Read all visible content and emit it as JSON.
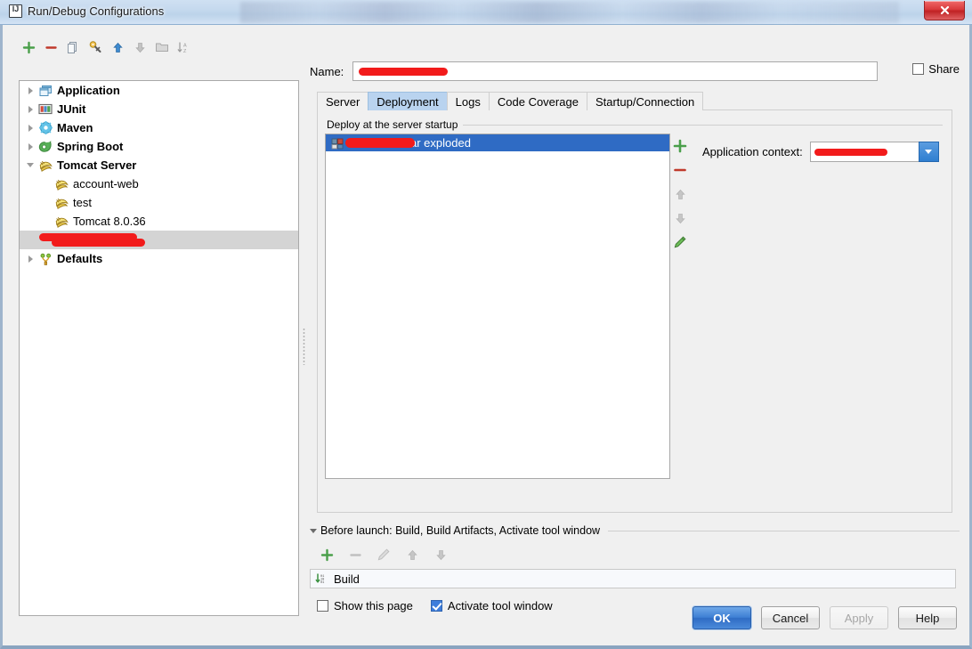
{
  "window": {
    "title": "Run/Debug Configurations",
    "logo_icon": "intellij-idea-icon",
    "close_label": "✕"
  },
  "left_toolbar": {
    "buttons": [
      {
        "name": "add-configuration-button",
        "icon": "plus-icon",
        "tooltip": "Add New Configuration",
        "enabled": true
      },
      {
        "name": "remove-configuration-button",
        "icon": "minus-icon",
        "tooltip": "Remove Configuration",
        "enabled": true
      },
      {
        "name": "copy-configuration-button",
        "icon": "copy-icon",
        "tooltip": "Copy Configuration",
        "enabled": false
      },
      {
        "name": "edit-templates-button",
        "icon": "wrench-icon",
        "tooltip": "Edit Templates",
        "enabled": true
      },
      {
        "name": "move-up-button",
        "icon": "arrow-up-icon",
        "tooltip": "Move Up",
        "enabled": true
      },
      {
        "name": "move-down-button",
        "icon": "arrow-down-icon",
        "tooltip": "Move Down",
        "enabled": false
      },
      {
        "name": "create-folder-button",
        "icon": "folder-icon",
        "tooltip": "Create New Folder",
        "enabled": false
      },
      {
        "name": "sort-configurations-button",
        "icon": "sort-az-icon",
        "tooltip": "Sort Configurations",
        "enabled": false
      }
    ]
  },
  "tree": {
    "items": [
      {
        "label": "Application",
        "icon": "application-icon",
        "twisty": "collapsed",
        "bold": true,
        "child": false,
        "selected": false
      },
      {
        "label": "JUnit",
        "icon": "junit-icon",
        "twisty": "collapsed",
        "bold": true,
        "child": false,
        "selected": false
      },
      {
        "label": "Maven",
        "icon": "maven-icon",
        "twisty": "collapsed",
        "bold": true,
        "child": false,
        "selected": false
      },
      {
        "label": "Spring Boot",
        "icon": "spring-boot-icon",
        "twisty": "collapsed",
        "bold": true,
        "child": false,
        "selected": false
      },
      {
        "label": "Tomcat Server",
        "icon": "tomcat-icon",
        "twisty": "expanded",
        "bold": true,
        "child": false,
        "selected": false
      },
      {
        "label": "account-web",
        "icon": "tomcat-icon",
        "twisty": "none",
        "bold": false,
        "child": true,
        "selected": false
      },
      {
        "label": "test",
        "icon": "tomcat-icon",
        "twisty": "none",
        "bold": false,
        "child": true,
        "selected": false
      },
      {
        "label": "Tomcat 8.0.36",
        "icon": "tomcat-icon",
        "twisty": "none",
        "bold": false,
        "child": true,
        "selected": false
      },
      {
        "label": "",
        "icon": "tomcat-icon",
        "twisty": "none",
        "bold": false,
        "child": true,
        "selected": true,
        "redacted": true
      },
      {
        "label": "Defaults",
        "icon": "defaults-icon",
        "twisty": "collapsed",
        "bold": true,
        "child": false,
        "selected": false
      }
    ]
  },
  "name_field": {
    "label": "Name:",
    "value": "",
    "redacted": true
  },
  "share": {
    "label": "Share",
    "checked": false
  },
  "tabs": [
    {
      "label": "Server",
      "active": false
    },
    {
      "label": "Deployment",
      "active": true
    },
    {
      "label": "Logs",
      "active": false
    },
    {
      "label": "Code Coverage",
      "active": false
    },
    {
      "label": "Startup/Connection",
      "active": false
    }
  ],
  "deployment": {
    "section_title": "Deploy at the server startup",
    "rows": [
      {
        "label": ":war exploded",
        "icon": "artifact-icon",
        "selected": true,
        "redacted": true
      }
    ],
    "side_buttons": [
      {
        "name": "add-artifact-button",
        "icon": "plus-icon",
        "enabled": true
      },
      {
        "name": "remove-artifact-button",
        "icon": "minus-icon",
        "enabled": true
      },
      {
        "name": "move-artifact-up-button",
        "icon": "arrow-up-icon",
        "enabled": false
      },
      {
        "name": "move-artifact-down-button",
        "icon": "arrow-down-icon",
        "enabled": false
      },
      {
        "name": "edit-artifact-button",
        "icon": "pencil-icon",
        "enabled": true
      }
    ],
    "application_context": {
      "label": "Application context:",
      "value": "",
      "redacted": true
    }
  },
  "before_launch": {
    "header": "Before launch: Build, Build Artifacts, Activate tool window",
    "toolbar": [
      {
        "name": "add-task-button",
        "icon": "plus-icon",
        "enabled": true
      },
      {
        "name": "remove-task-button",
        "icon": "minus-icon",
        "enabled": false
      },
      {
        "name": "edit-task-button",
        "icon": "pencil-icon",
        "enabled": false
      },
      {
        "name": "move-task-up-button",
        "icon": "arrow-up-icon",
        "enabled": false
      },
      {
        "name": "move-task-down-button",
        "icon": "arrow-down-icon",
        "enabled": false
      }
    ],
    "tasks": [
      {
        "label": "Build",
        "icon": "build-icon"
      }
    ],
    "show_this_page": {
      "label": "Show this page",
      "checked": false
    },
    "activate_tool_window": {
      "label": "Activate tool window",
      "checked": true
    }
  },
  "buttons": {
    "ok": "OK",
    "cancel": "Cancel",
    "apply": "Apply",
    "help": "Help"
  },
  "colors": {
    "accent_blue": "#2f6bc4",
    "selection_gray": "#d4d4d4",
    "redaction_red": "#f21b1b",
    "tab_active": "#b9d3ef",
    "title_close_red": "#c02224"
  }
}
